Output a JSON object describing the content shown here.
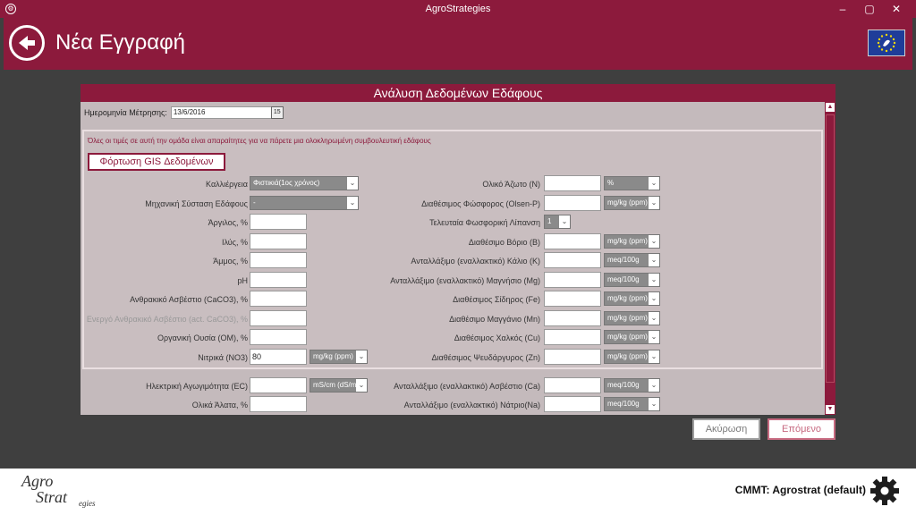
{
  "window": {
    "title": "AgroStrategies",
    "minimize": "–",
    "maximize": "▢",
    "close": "✕"
  },
  "header": {
    "title": "Νέα Εγγραφή"
  },
  "panel": {
    "title": "Ανάλυση Δεδομένων Εδάφους",
    "date_label": "Ημερομηνία Μέτρησης:",
    "date_value": "13/6/2016",
    "calendar_icon_text": "15",
    "note": "Όλες οι τιμές σε αυτή την ομάδα είναι απαραίτητες για να πάρετε μια ολοκληρωμένη συμβουλευτική εδάφους",
    "gis_button": "Φόρτωση GIS Δεδομένων"
  },
  "left": {
    "crop_label": "Καλλιέργεια",
    "crop_value": "Φιστικιά(1ος χρόνος)",
    "texture_label": "Μηχανική Σύσταση Εδάφους",
    "texture_value": "-",
    "clay_label": "Άργιλος, %",
    "silt_label": "Ιλύς, %",
    "sand_label": "Άμμος, %",
    "ph_label": "pH",
    "caco3_label": "Ανθρακικό Ασβέστιο (CaCO3), %",
    "actcaco3_label": "Ενεργό Ανθρακικό Ασβέστιο (act. CaCO3), %",
    "om_label": "Οργανική Ουσία (OM), %",
    "no3_label": "Νιτρικά (NO3)",
    "no3_value": "80",
    "no3_unit": "mg/kg (ppm)",
    "ec_label": "Ηλεκτρική Αγωγιμότητα (EC)",
    "ec_unit": "mS/cm (dS/m)",
    "salts_label": "Ολικά Άλατα, %"
  },
  "right": {
    "n_label": "Ολικό Άζωτο (N)",
    "n_unit": "%",
    "p_label": "Διαθέσιμος Φώσφορος (Olsen-P)",
    "p_unit": "mg/kg (ppm)",
    "lastp_label": "Τελευταία Φωσφορική Λίπανση",
    "lastp_value": "1",
    "b_label": "Διαθέσιμο Βόριο (B)",
    "b_unit": "mg/kg (ppm)",
    "k_label": "Ανταλλάξιμο (εναλλακτικό) Κάλιο (K)",
    "k_unit": "meq/100g",
    "mg_label": "Ανταλλάξιμο (εναλλακτικό) Μαγνήσιο (Mg)",
    "mg_unit": "meq/100g",
    "fe_label": "Διαθέσιμος Σίδηρος (Fe)",
    "fe_unit": "mg/kg (ppm)",
    "mn_label": "Διαθέσιμο Μαγγάνιο (Mn)",
    "mn_unit": "mg/kg (ppm)",
    "cu_label": "Διαθέσιμος Χαλκός (Cu)",
    "cu_unit": "mg/kg (ppm)",
    "zn_label": "Διαθέσιμος Ψευδάργυρος (Zn)",
    "zn_unit": "mg/kg (ppm)",
    "ca_label": "Ανταλλάξιμο (εναλλακτικό) Ασβέστιο (Ca)",
    "ca_unit": "meq/100g",
    "na_label": "Ανταλλάξιμο (εναλλακτικό) Νάτριο(Na)",
    "na_unit": "meq/100g"
  },
  "footer": {
    "cancel": "Ακύρωση",
    "next": "Επόμενο",
    "user": "CMMT: Agrostrat (default)"
  },
  "logo": {
    "line1": "Agro",
    "line2": "Strat",
    "line3": "egies"
  },
  "colors": {
    "brand": "#8c1a3c",
    "panel": "#c4babc"
  }
}
